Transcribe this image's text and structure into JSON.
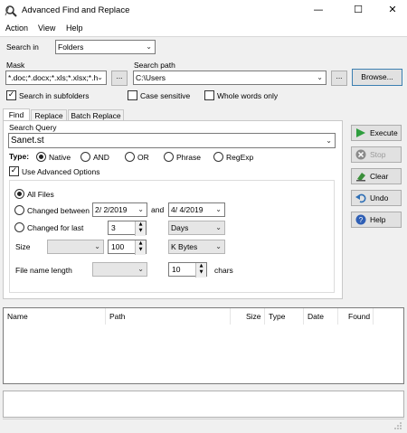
{
  "window": {
    "title": "Advanced Find and Replace",
    "minimize": "—",
    "maximize": "☐",
    "close": "✕"
  },
  "menu": [
    "Action",
    "View",
    "Help"
  ],
  "search_in": {
    "label": "Search in",
    "value": "Folders"
  },
  "mask": {
    "label": "Mask",
    "value": "*.doc;*.docx;*.xls;*.xlsx;*.h",
    "browse_small": "..."
  },
  "search_path": {
    "label": "Search path",
    "value": "C:\\Users",
    "browse_small": "...",
    "browse_button": "Browse..."
  },
  "options": {
    "search_in_subfolders": {
      "label": "Search in subfolders",
      "checked": true
    },
    "case_sensitive": {
      "label": "Case sensitive",
      "checked": false
    },
    "whole_words_only": {
      "label": "Whole words only",
      "checked": false
    }
  },
  "tabs": [
    {
      "label": "Find",
      "active": true
    },
    {
      "label": "Replace",
      "active": false
    },
    {
      "label": "Batch Replace",
      "active": false
    }
  ],
  "query": {
    "label": "Search Query",
    "value": "Sanet.st"
  },
  "type": {
    "label": "Type:",
    "options": [
      "Native",
      "AND",
      "OR",
      "Phrase",
      "RegExp"
    ],
    "selected": "Native"
  },
  "advanced": {
    "label": "Use Advanced Options",
    "checked": true,
    "all_files": "All Files",
    "changed_between": {
      "label": "Changed between",
      "from": "2/  2/2019",
      "and_label": "and",
      "to": "4/  4/2019"
    },
    "changed_for_last": {
      "label": "Changed for last",
      "value": "3",
      "unit": "Days"
    },
    "size": {
      "label": "Size",
      "operator": "",
      "value": "100",
      "unit": "K Bytes"
    },
    "file_name_length": {
      "label": "File name length",
      "operator": "",
      "value": "10",
      "unit_label": "chars"
    },
    "selected": "All Files"
  },
  "side_buttons": [
    "Execute",
    "Stop",
    "Clear",
    "Undo",
    "Help"
  ],
  "results": {
    "columns": [
      "Name",
      "Path",
      "Size",
      "Type",
      "Date",
      "Found"
    ]
  },
  "colors": {
    "execute": "#2e9e3e",
    "stop": "#888888",
    "clear": "#3a8f3a",
    "undo": "#2f6fb5",
    "help": "#2f5fb5"
  }
}
